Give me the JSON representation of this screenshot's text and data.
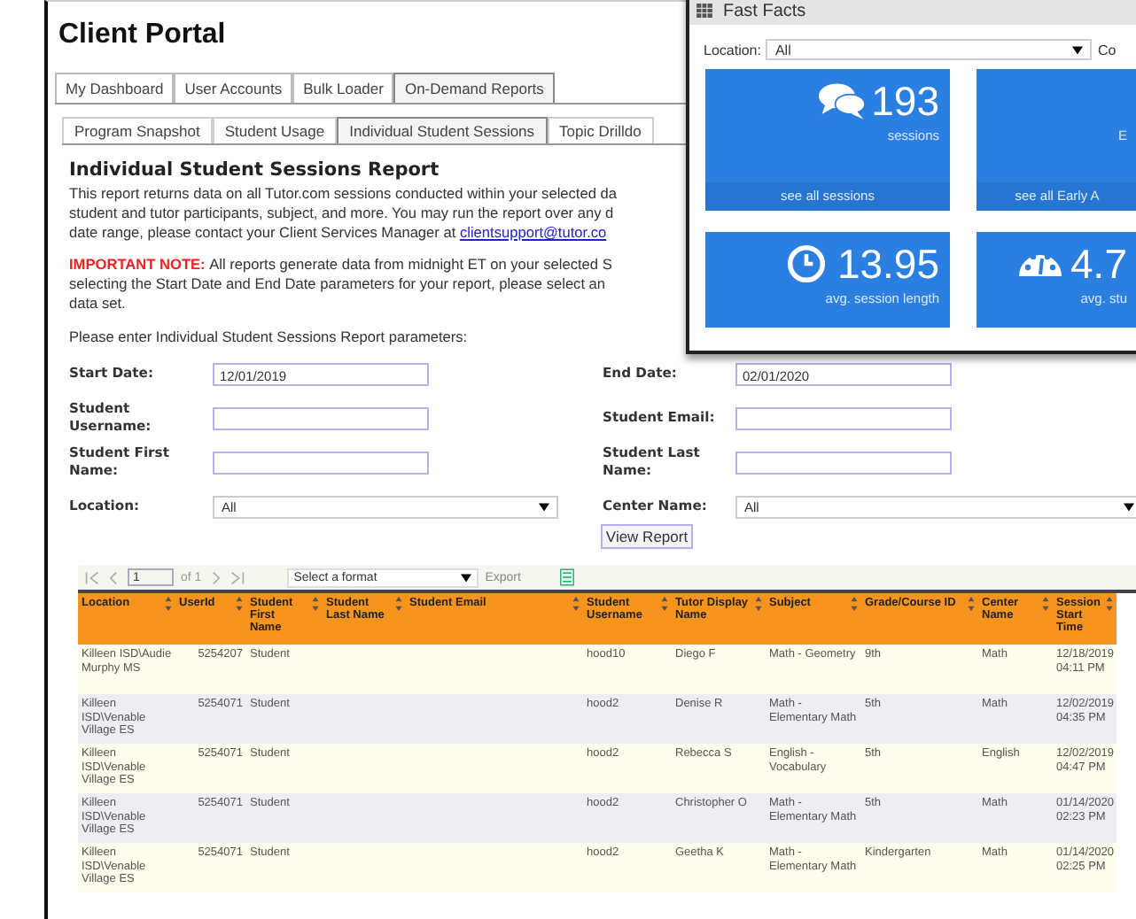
{
  "title": "Client Portal",
  "tabs": [
    {
      "label": "My Dashboard",
      "selected": false
    },
    {
      "label": "User Accounts",
      "selected": false
    },
    {
      "label": "Bulk Loader",
      "selected": false
    },
    {
      "label": "On-Demand Reports",
      "selected": true
    }
  ],
  "subtabs": [
    {
      "label": "Program Snapshot",
      "selected": false
    },
    {
      "label": "Student Usage",
      "selected": false
    },
    {
      "label": "Individual Student Sessions",
      "selected": true
    },
    {
      "label": "Topic Drilldo",
      "selected": false
    }
  ],
  "report": {
    "heading": "Individual Student Sessions Report",
    "intro_lines": [
      "This report returns data on all Tutor.com sessions conducted within your selected da",
      "student and tutor participants, subject, and more. You may run the report over any d",
      "date range, please contact your Client Services Manager at"
    ],
    "intro_link": "clientsupport@tutor.co",
    "note_label": "IMPORTANT NOTE:",
    "note_lines": [
      "All reports generate data from midnight ET on your selected S",
      "selecting the Start Date and End Date parameters for your report, please select an",
      "data set."
    ],
    "prompt": "Please enter Individual Student Sessions Report parameters:"
  },
  "form": [
    {
      "label": "Start Date:",
      "kind": "input",
      "value": "12/01/2019"
    },
    {
      "label": "End Date:",
      "kind": "input",
      "value": "02/01/2020"
    },
    {
      "label": "Student Username:",
      "kind": "input"
    },
    {
      "label": "Student Email:",
      "kind": "input"
    },
    {
      "label": "Student First Name:",
      "kind": "input"
    },
    {
      "label": "Student Last Name:",
      "kind": "input"
    },
    {
      "label": "Location:",
      "kind": "select",
      "value": "All"
    },
    {
      "label": "Center Name:",
      "kind": "select",
      "value": "All"
    }
  ],
  "view_button": "View Report",
  "pager": {
    "page": "1",
    "of": "of 1",
    "format": "Select a format",
    "export": "Export",
    "export_disabled": true
  },
  "table": {
    "columns": [
      "Location",
      "UserId",
      "Student First Name",
      "Student Last Name",
      "Student Email",
      "Student Username",
      "Tutor Display Name",
      "Subject",
      "Grade/Course ID",
      "Center Name",
      "Session Start Time"
    ],
    "rows": [
      [
        "Killeen ISD\\Audie Murphy MS",
        "5254207",
        "Student",
        "",
        "",
        "hood10",
        "Diego F",
        "Math - Geometry",
        "9th",
        "Math",
        "12/18/2019 04:11 PM"
      ],
      [
        "Killeen ISD\\Venable Village ES",
        "5254071",
        "Student",
        "",
        "",
        "hood2",
        "Denise R",
        "Math - Elementary Math",
        "5th",
        "Math",
        "12/02/2019 04:35 PM"
      ],
      [
        "Killeen ISD\\Venable Village ES",
        "5254071",
        "Student",
        "",
        "",
        "hood2",
        "Rebecca S",
        "English - Vocabulary",
        "5th",
        "English",
        "12/02/2019 04:47 PM"
      ],
      [
        "Killeen ISD\\Venable Village ES",
        "5254071",
        "Student",
        "",
        "",
        "hood2",
        "Christopher O",
        "Math - Elementary Math",
        "5th",
        "Math",
        "01/14/2020 02:23 PM"
      ],
      [
        "Killeen ISD\\Venable Village ES",
        "5254071",
        "Student",
        "",
        "",
        "hood2",
        "Geetha K",
        "Math - Elementary Math",
        "Kindergarten",
        "Math",
        "01/14/2020 02:25 PM"
      ]
    ]
  },
  "fast_facts": {
    "title": "Fast Facts",
    "location_label": "Location:",
    "location_value": "All",
    "next_label": "Co",
    "cards": [
      {
        "value": "193",
        "label": "sessions",
        "footer": "see all sessions"
      },
      {
        "label": "E",
        "footer": "see all Early A"
      },
      {
        "value": "13.95",
        "label": "avg. session length"
      },
      {
        "value": "4.7",
        "label": "avg. stu"
      }
    ]
  }
}
